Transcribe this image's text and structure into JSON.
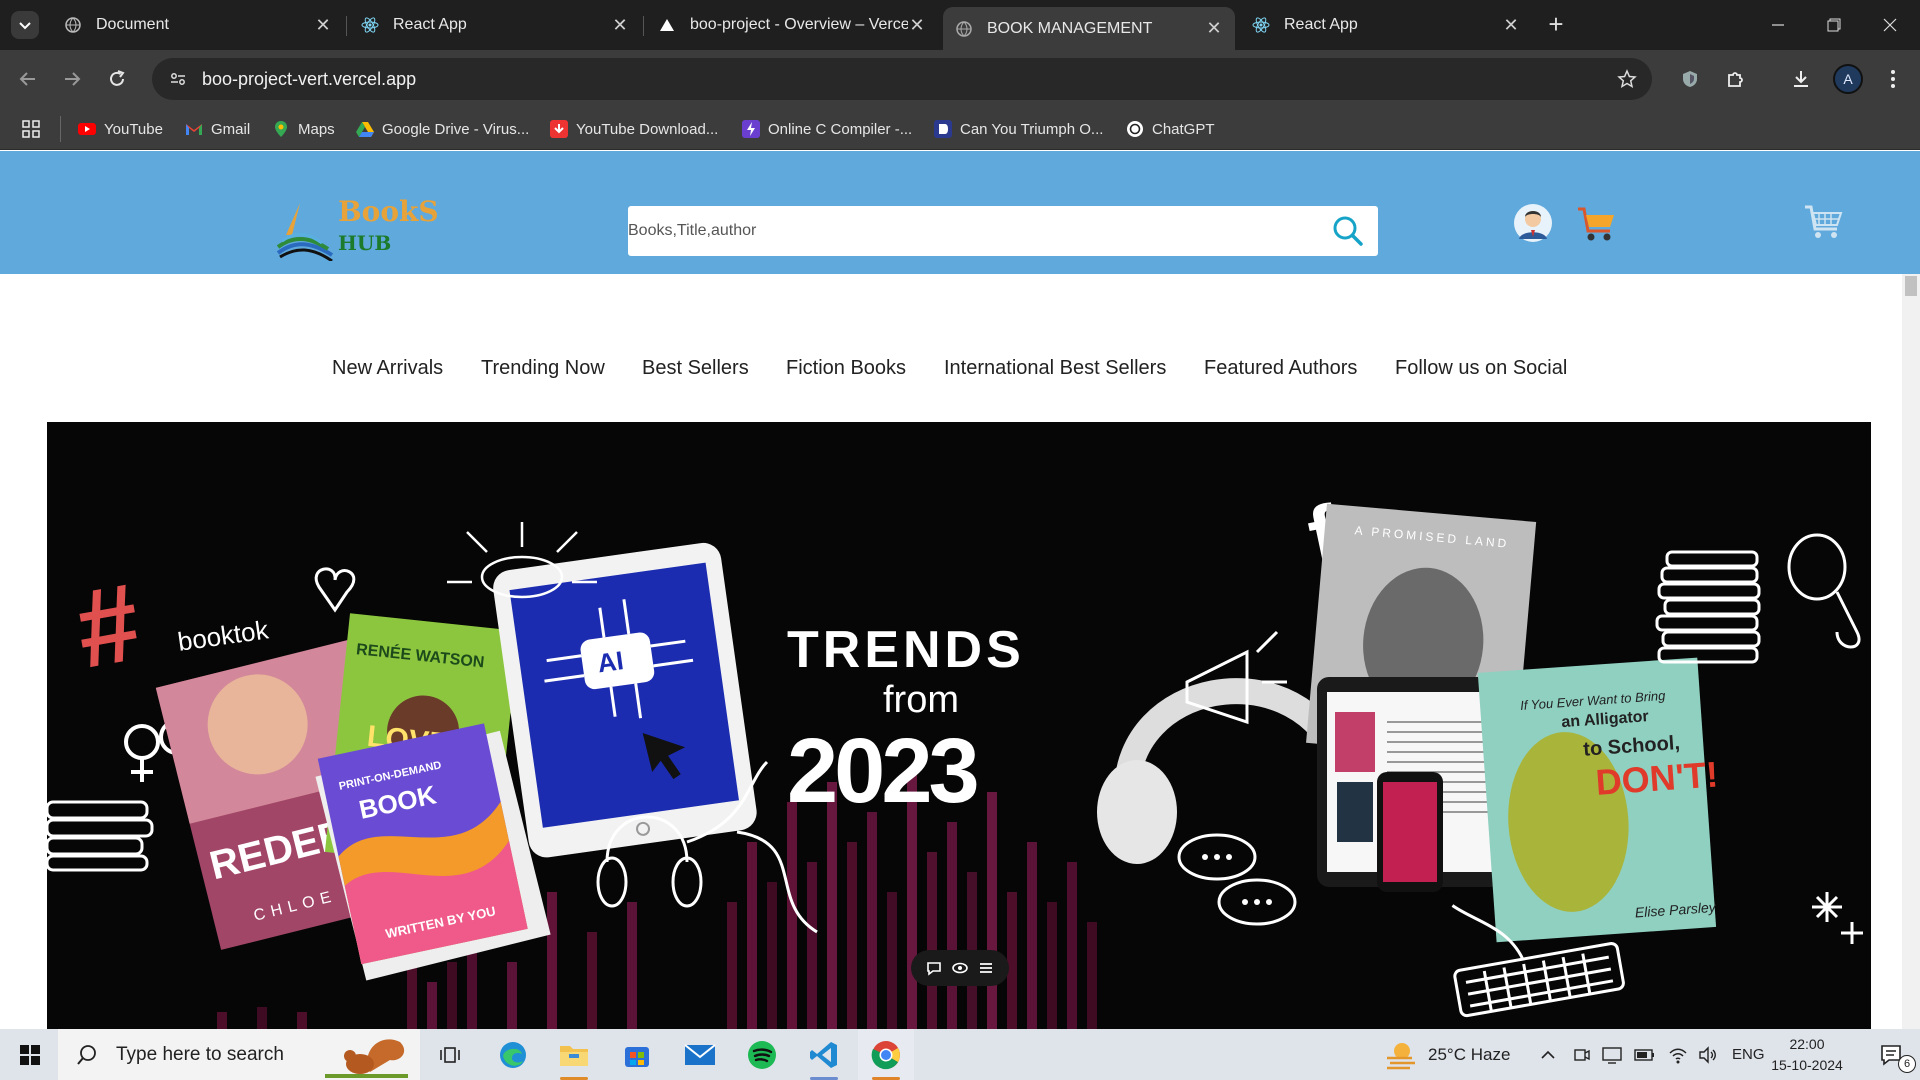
{
  "browser": {
    "tabs": [
      {
        "title": "Document",
        "active": false,
        "favicon": "globe-icon"
      },
      {
        "title": "React App",
        "active": false,
        "favicon": "react-icon"
      },
      {
        "title": "boo-project - Overview – Vercel",
        "active": false,
        "favicon": "vercel-icon"
      },
      {
        "title": "BOOK MANAGEMENT",
        "active": true,
        "favicon": "globe-icon"
      },
      {
        "title": "React App",
        "active": false,
        "favicon": "react-icon"
      }
    ],
    "new_tab_label": "+",
    "url": "boo-project-vert.vercel.app",
    "profile_initial": "A",
    "bookmarks": [
      {
        "label": "YouTube",
        "icon": "youtube-icon"
      },
      {
        "label": "Gmail",
        "icon": "gmail-icon"
      },
      {
        "label": "Maps",
        "icon": "maps-icon"
      },
      {
        "label": "Google Drive - Virus...",
        "icon": "drive-icon"
      },
      {
        "label": "YouTube Download...",
        "icon": "download-icon"
      },
      {
        "label": "Online C Compiler -...",
        "icon": "bolt-icon"
      },
      {
        "label": "Can You Triumph O...",
        "icon": "bookmark-icon"
      },
      {
        "label": "ChatGPT",
        "icon": "chatgpt-icon"
      }
    ]
  },
  "site": {
    "logo": {
      "line1": "BookS",
      "line2": "HUB"
    },
    "search_placeholder": "Books,Title,author",
    "nav": [
      "New Arrivals",
      "Trending Now",
      "Best Sellers",
      "Fiction Books",
      "International Best Sellers",
      "Featured Authors",
      "Follow us on Social"
    ],
    "banner": {
      "hashtag": "#",
      "booktok": "booktok",
      "headline1": "TRENDS",
      "headline2": "from",
      "headline3": "2023",
      "book1_author": "RENÉE WATSON",
      "book1_title": "LOVE",
      "book2_top": "PRINT-ON-DEMAND",
      "book2_title": "BOOK",
      "book2_sub": "WRITTEN BY YOU",
      "book3_title": "REDEEMI",
      "book3_author": "CHLOE WA",
      "tablet_label": "AI",
      "promised": "A PROMISED LAND",
      "kids1": "If You Ever Want to Bring",
      "kids2": "an Alligator",
      "kids3": "to School,",
      "kids4": "DON'T!",
      "kids_author": "Elise Parsley",
      "fb": "f"
    }
  },
  "taskbar": {
    "search_label": "Type here to search",
    "weather": "25°C  Haze",
    "language": "ENG",
    "time": "22:00",
    "date": "15-10-2024",
    "notifications": "6"
  },
  "colors": {
    "header_bg": "#5fa9dc",
    "logo_orange": "#e7a33a",
    "logo_green": "#1c7a2b"
  }
}
